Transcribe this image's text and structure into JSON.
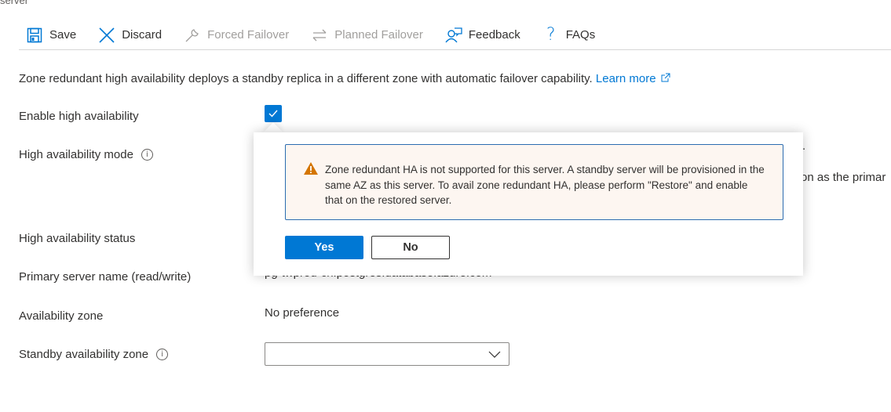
{
  "breadcrumb": "server",
  "toolbar": {
    "save": "Save",
    "discard": "Discard",
    "forced_failover": "Forced Failover",
    "planned_failover": "Planned Failover",
    "feedback": "Feedback",
    "faqs": "FAQs"
  },
  "description": {
    "text": "Zone redundant high availability deploys a standby replica in a different zone with automatic failover capability.",
    "link": "Learn more"
  },
  "fields": {
    "enable_ha": {
      "label": "Enable high availability",
      "checked": true
    },
    "ha_mode": {
      "label": "High availability mode",
      "partial_text": "on as the primar",
      "partial_dot": "."
    },
    "ha_status": {
      "label": "High availability status"
    },
    "primary_server": {
      "label": "Primary server name (read/write)",
      "value": "pg-twprod-cn.postgres.database.azure.com"
    },
    "availability_zone": {
      "label": "Availability zone",
      "value": "No preference"
    },
    "standby_zone": {
      "label": "Standby availability zone",
      "value": ""
    }
  },
  "callout": {
    "message": "Zone redundant HA is not supported for this server. A standby server will be provisioned in the same AZ as this server. To avail zone redundant HA, please perform \"Restore\" and enable that on the restored server.",
    "yes": "Yes",
    "no": "No"
  },
  "colors": {
    "accent": "#0078d4",
    "warning": "#d47500",
    "warning_bg": "#fdf6f1"
  }
}
